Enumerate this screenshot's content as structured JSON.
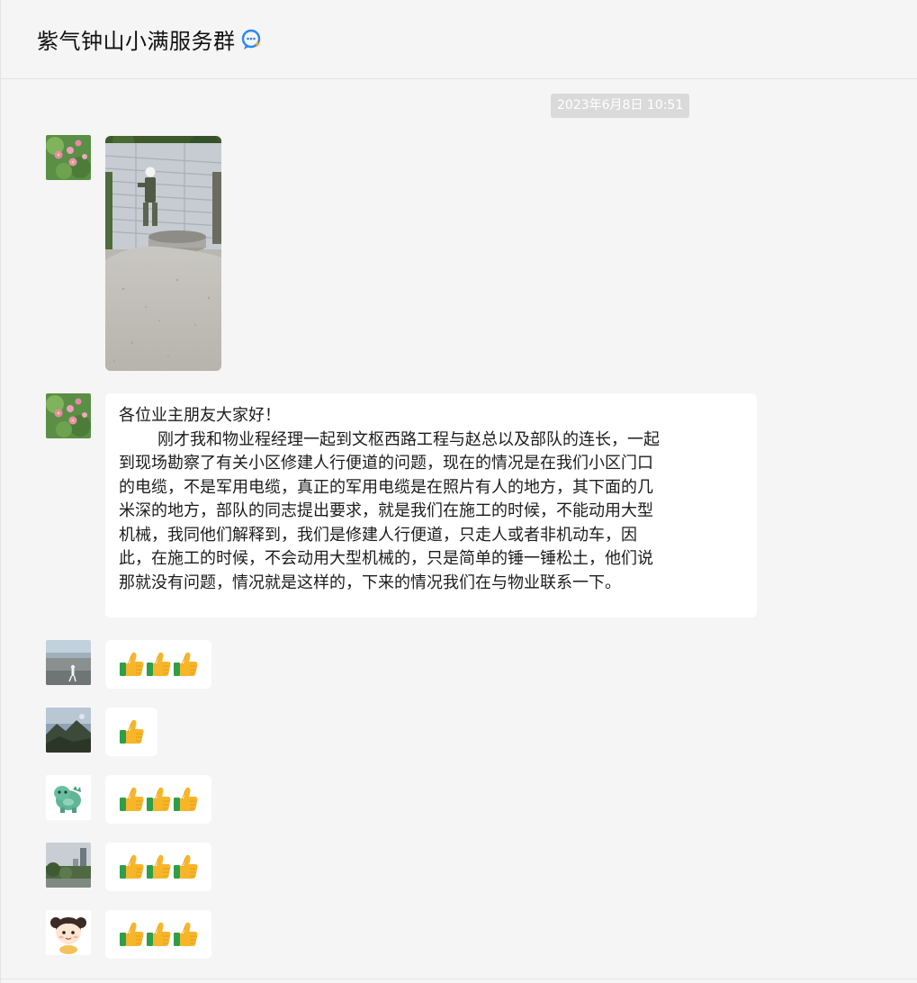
{
  "header": {
    "title": "紫气钟山小满服务群",
    "title_icon": "group-chat-icon"
  },
  "chat": {
    "timestamp": "2023年6月8日 10:51",
    "messages": [
      {
        "type": "image",
        "avatar": "avatar-flowers",
        "content": "construction-site-photo"
      },
      {
        "type": "text",
        "avatar": "avatar-flowers",
        "lines": [
          "各位业主朋友大家好！",
          "刚才我和物业程经理一起到文枢西路工程与赵总以及部队的连长，一起",
          "到现场勘察了有关小区修建人行便道的问题，现在的情况是在我们小区门口",
          "的电缆，不是军用电缆，真正的军用电缆是在照片有人的地方，其下面的几",
          "米深的地方，部队的同志提出要求，就是我们在施工的时候，不能动用大型",
          "机械，我同他们解释到，我们是修建人行便道，只走人或者非机动车，因",
          "此，在施工的时候，不会动用大型机械的，只是简单的锤一锤松土，他们说",
          "那就没有问题，情况就是这样的，下来的情况我们在与物业联系一下。"
        ]
      },
      {
        "type": "emoji",
        "avatar": "avatar-beach",
        "emoji": "thumbs-up-icon",
        "count": 3
      },
      {
        "type": "emoji",
        "avatar": "avatar-mountain",
        "emoji": "thumbs-up-icon",
        "count": 1
      },
      {
        "type": "emoji",
        "avatar": "avatar-dinosaur",
        "emoji": "thumbs-up-icon",
        "count": 3
      },
      {
        "type": "emoji",
        "avatar": "avatar-city",
        "emoji": "thumbs-up-icon",
        "count": 3
      },
      {
        "type": "emoji",
        "avatar": "avatar-cartoon-girl",
        "emoji": "thumbs-up-icon",
        "count": 3
      }
    ]
  },
  "colors": {
    "background": "#f5f5f5",
    "bubble": "#ffffff",
    "timestamp_bg": "#dadada",
    "thumb": "#f7b52a"
  }
}
